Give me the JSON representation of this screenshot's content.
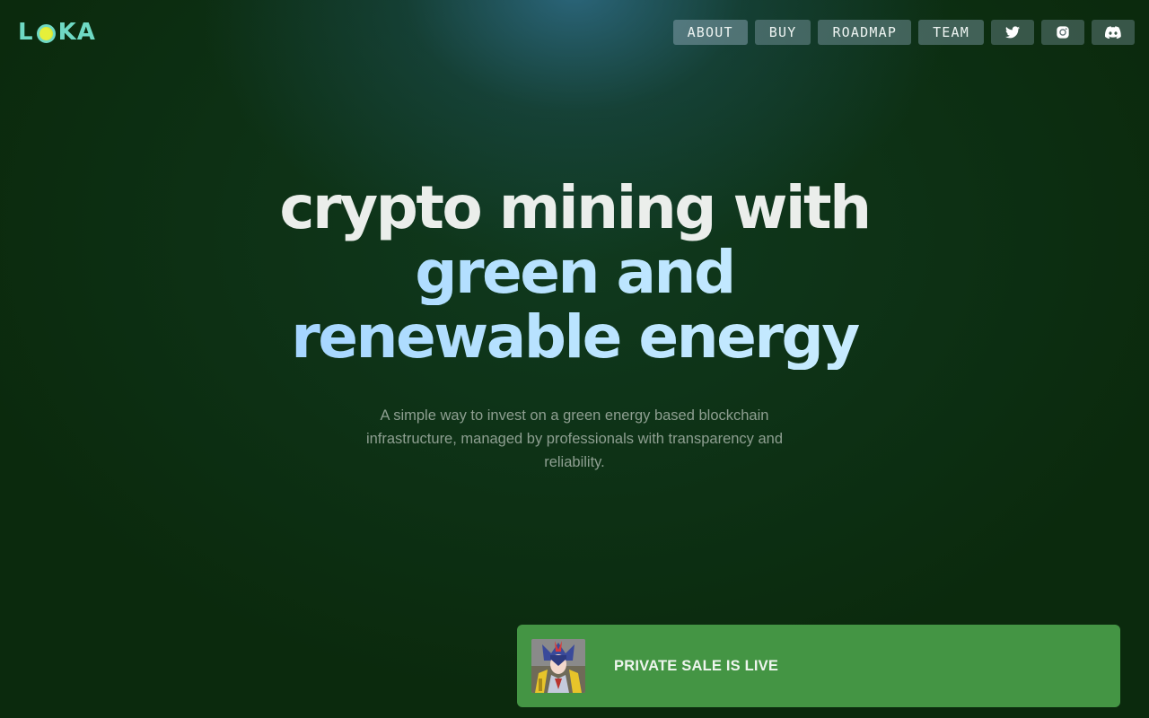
{
  "brand": {
    "logo_text_1": "L",
    "logo_text_2": "KA",
    "primary_color": "#6fd9c4",
    "accent_dot_color": "#e6ef3a"
  },
  "nav": {
    "items": [
      {
        "label": "ABOUT"
      },
      {
        "label": "BUY"
      },
      {
        "label": "ROADMAP"
      },
      {
        "label": "TEAM"
      }
    ],
    "social": [
      {
        "icon": "twitter-icon"
      },
      {
        "icon": "instagram-icon"
      },
      {
        "icon": "discord-icon"
      }
    ]
  },
  "hero": {
    "line1": "crypto mining with",
    "line2": "green and",
    "line3": "renewable energy",
    "subtitle": "A simple way to invest on a green energy based blockchain infrastructure, managed by professionals with transparency and reliability."
  },
  "sale_banner": {
    "label": "PRIVATE SALE IS LIVE",
    "background": "#449544"
  }
}
